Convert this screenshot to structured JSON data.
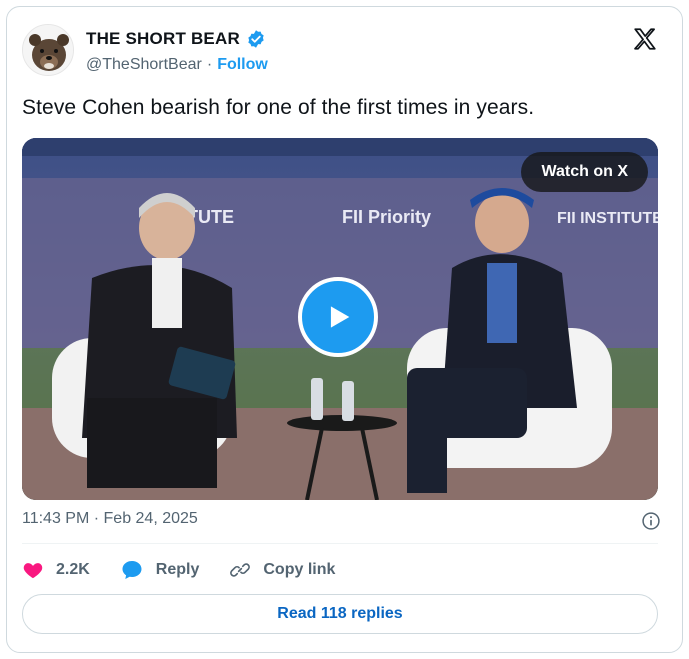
{
  "author": {
    "display_name": "THE SHORT BEAR",
    "handle": "@TheShortBear",
    "separator": "·",
    "follow_label": "Follow"
  },
  "tweet": {
    "text": "Steve Cohen bearish for one of the first times in years."
  },
  "media": {
    "watch_label": "Watch on X",
    "banner_left_text": "FII Priority",
    "banner_right_text": "FII INSTITUTE",
    "banner_left_partial": "ITUTE"
  },
  "meta": {
    "timestamp": "11:43 PM · Feb 24, 2025"
  },
  "actions": {
    "like_count": "2.2K",
    "reply_label": "Reply",
    "copy_label": "Copy link"
  },
  "replies": {
    "label": "Read 118 replies"
  },
  "colors": {
    "accent": "#1d9bf0",
    "like": "#f91880",
    "link": "#0a66c2",
    "muted": "#536471"
  },
  "icons": [
    "bear-avatar",
    "verified-badge-icon",
    "x-logo-icon",
    "play-icon",
    "info-icon",
    "heart-icon",
    "reply-icon",
    "link-icon"
  ]
}
